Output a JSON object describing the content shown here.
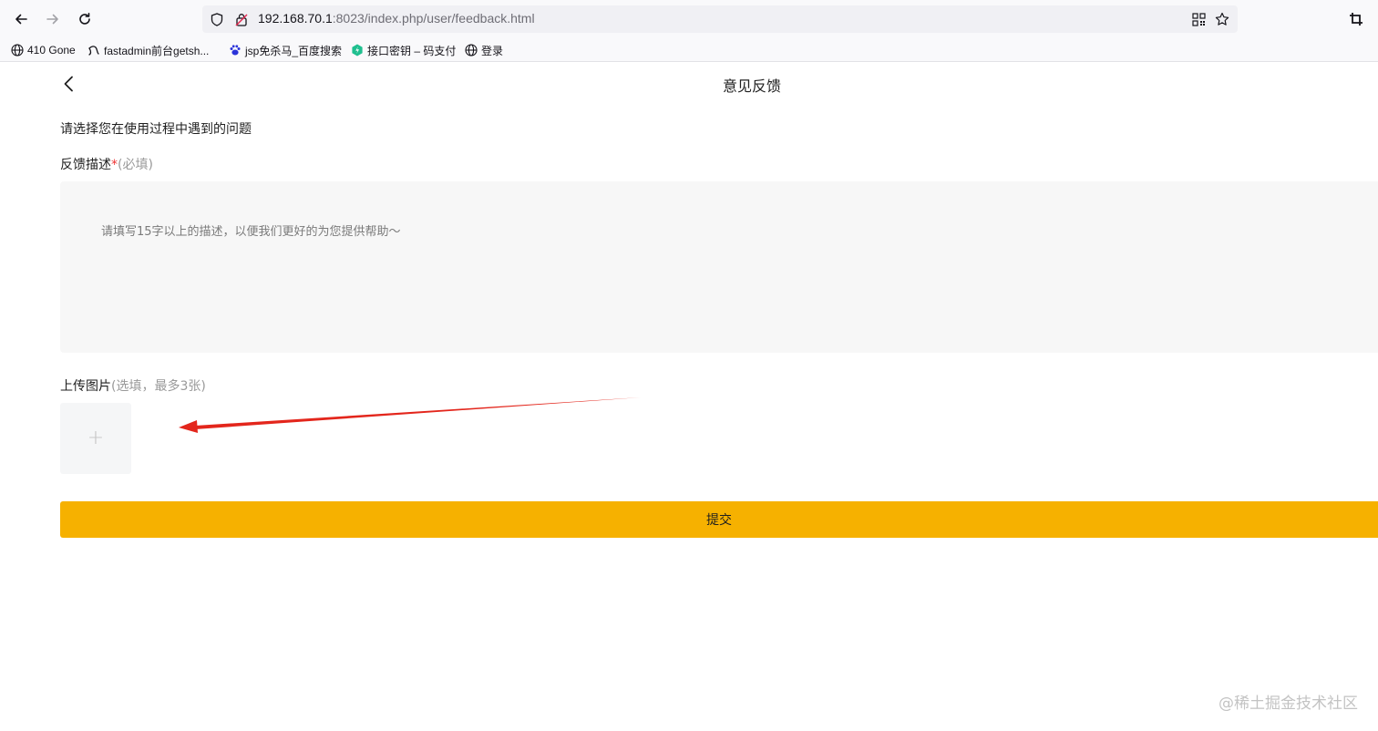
{
  "browser": {
    "url_host": "192.168.70.1",
    "url_rest": ":8023/index.php/user/feedback.html",
    "icons": [
      "back-arrow-icon",
      "forward-arrow-icon",
      "reload-icon",
      "shield-icon",
      "lock-warning-icon",
      "qr-code-icon",
      "star-icon",
      "crop-icon"
    ]
  },
  "bookmarks": [
    {
      "label": "410 Gone",
      "icon": "globe-icon"
    },
    {
      "label": "fastadmin前台getsh...",
      "icon": "script-icon"
    },
    {
      "label": "jsp免杀马_百度搜索",
      "icon": "baidu-paw-icon"
    },
    {
      "label": "接口密钥 – 码支付",
      "icon": "green-leaf-icon"
    },
    {
      "label": "登录",
      "icon": "globe-icon"
    }
  ],
  "page": {
    "title": "意见反馈",
    "question": "请选择您在使用过程中遇到的问题",
    "desc_label": "反馈描述",
    "required_star": "*",
    "required_hint": "(必填)",
    "desc_placeholder": "请填写15字以上的描述，以便我们更好的为您提供帮助～",
    "upload_label": "上传图片",
    "upload_hint": "(选填，最多3张)",
    "upload_plus": "+",
    "submit_label": "提交"
  },
  "colors": {
    "accent": "#f6b100",
    "annotation_arrow": "#e3261c"
  },
  "watermark": "@稀土掘金技术社区"
}
